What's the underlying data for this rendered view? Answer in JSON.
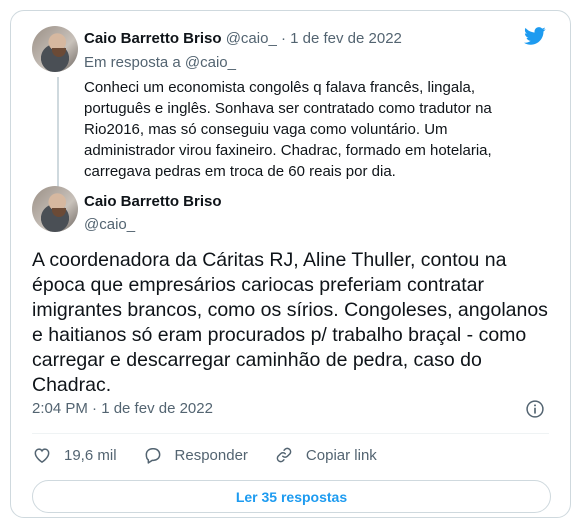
{
  "quoted": {
    "name": "Caio Barretto Briso",
    "handle": "@caio_",
    "separator": "·",
    "date": "1 de fev de 2022",
    "reply_to": "Em resposta a @caio_",
    "text": "Conheci um economista congolês q falava francês, lingala, português e inglês. Sonhava ser contratado como tradutor na Rio2016, mas só conseguiu vaga como voluntário. Um administrador virou faxineiro. Chadrac, formado em hotelaria, carregava pedras em troca de 60 reais por dia."
  },
  "main": {
    "name": "Caio Barretto Briso",
    "handle": "@caio_",
    "text": "A coordenadora da Cáritas RJ, Aline Thuller, contou na época que empresários cariocas preferiam contratar imigrantes brancos, como os sírios. Congoleses, angolanos e haitianos só eram procurados p/ trabalho braçal - como carregar e descarregar caminhão de pedra, caso do Chadrac.",
    "timestamp": "2:04 PM · 1 de fev de 2022"
  },
  "actions": {
    "likes": "19,6 mil",
    "reply_label": "Responder",
    "copy_label": "Copiar link"
  },
  "more_replies_label": "Ler 35 respostas",
  "colors": {
    "brand": "#1d9bf0",
    "like": "#536471",
    "text": "#0f1419",
    "muted": "#536471"
  },
  "icons": [
    "twitter-logo-icon",
    "info-icon",
    "heart-icon",
    "reply-icon",
    "link-icon"
  ]
}
